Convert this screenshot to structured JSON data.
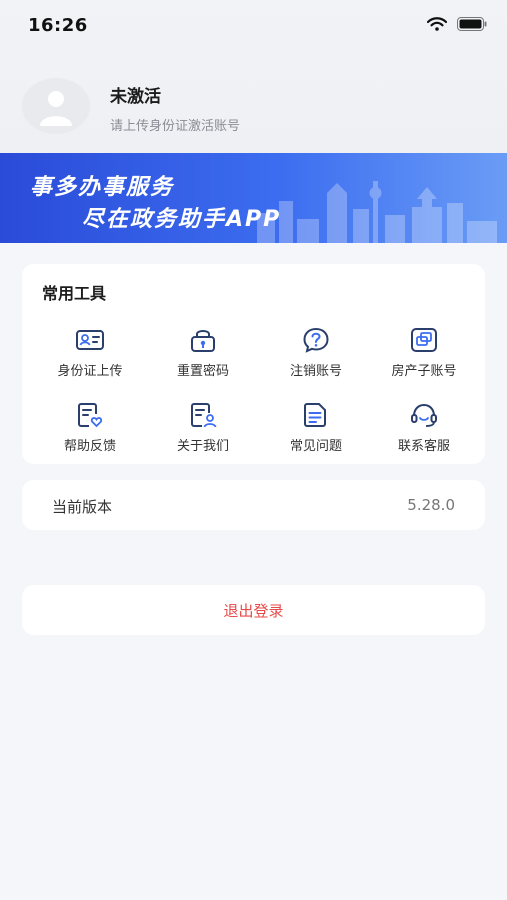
{
  "status_bar": {
    "time": "16:26"
  },
  "profile": {
    "name": "未激活",
    "hint": "请上传身份证激活账号"
  },
  "banner": {
    "line1": "事多办事服务",
    "line2": "尽在政务助手APP"
  },
  "tools": {
    "title": "常用工具",
    "items": [
      {
        "label": "身份证上传",
        "icon": "id-card-icon"
      },
      {
        "label": "重置密码",
        "icon": "lock-reset-icon"
      },
      {
        "label": "注销账号",
        "icon": "question-icon"
      },
      {
        "label": "房产子账号",
        "icon": "layers-icon"
      },
      {
        "label": "帮助反馈",
        "icon": "feedback-heart-icon"
      },
      {
        "label": "关于我们",
        "icon": "about-user-icon"
      },
      {
        "label": "常见问题",
        "icon": "document-icon"
      },
      {
        "label": "联系客服",
        "icon": "headset-icon"
      }
    ]
  },
  "version": {
    "label": "当前版本",
    "value": "5.28.0"
  },
  "logout": {
    "label": "退出登录"
  },
  "colors": {
    "accent": "#3c6df0",
    "danger": "#e84a4a",
    "icon": "#2b3f6c"
  }
}
